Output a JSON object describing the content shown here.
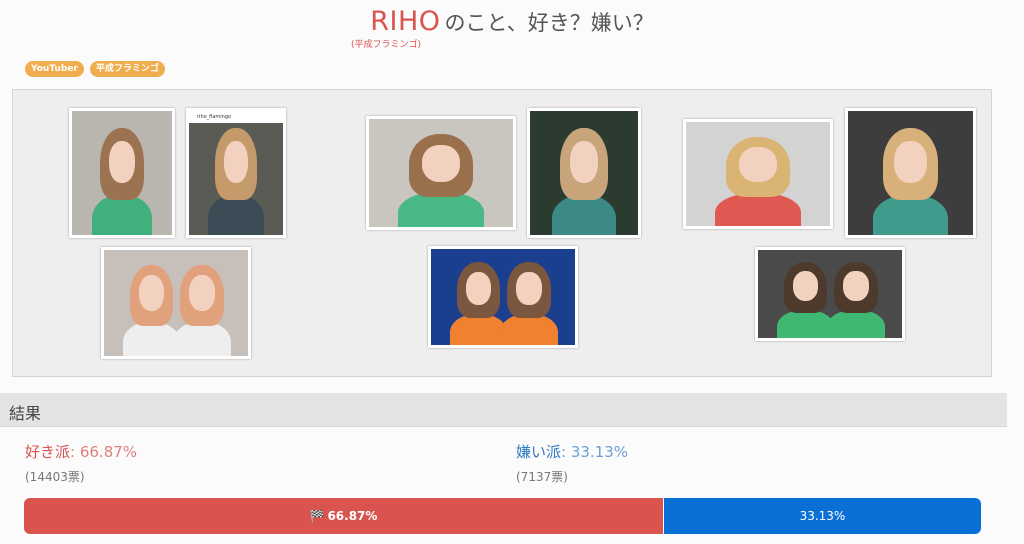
{
  "title": {
    "name": "RIHO",
    "rest": "のこと、好き？嫌い？",
    "sub": "(平成フラミンゴ)"
  },
  "tags": [
    "YouTuber",
    "平成フラミンゴ"
  ],
  "gallery": {
    "photos": [
      {
        "name": "photo-riho-green-sweater-1",
        "bg": "#b9b6b0",
        "hair": "#9c7350",
        "shirt": "#42b07d"
      },
      {
        "name": "photo-riho-instagram-post",
        "bg": "#5b5b55",
        "hair": "#c49a6a",
        "shirt": "#3c4c57",
        "caption": "riho_flamingo"
      },
      {
        "name": "photo-riho-green-sweater-2",
        "bg": "#c9c5bf",
        "hair": "#9a6f4c",
        "shirt": "#4ab884"
      },
      {
        "name": "photo-riho-graphic-tee",
        "bg": "#2b3b30",
        "hair": "#c8a47b",
        "shirt": "#3b8a86"
      },
      {
        "name": "photo-riho-red-sweater",
        "bg": "#d3d3d3",
        "hair": "#d9b472",
        "shirt": "#e05852"
      },
      {
        "name": "photo-riho-in-car",
        "bg": "#3d3d3d",
        "hair": "#d7b07a",
        "shirt": "#3f9b8c"
      },
      {
        "name": "photo-riho-peace-sign-duo",
        "bg": "#c7bfb9",
        "hair": "#e0a17c",
        "shirt": "#eeeeee"
      },
      {
        "name": "photo-riho-stage-duo",
        "bg": "#1b3f8f",
        "hair": "#7b5740",
        "shirt": "#f08130"
      },
      {
        "name": "photo-riho-sofa-duo",
        "bg": "#4a4a4a",
        "hair": "#4e3a2c",
        "shirt": "#3fb874"
      }
    ]
  },
  "results": {
    "heading": "結果",
    "like_label": "好き派",
    "like_pct": "66.87%",
    "like_votes": "(14403票)",
    "dislike_label": "嫌い派",
    "dislike_pct": "33.13%",
    "dislike_votes": "(7137票)",
    "like_ratio": 0.6687,
    "bar_like_text": "66.87%",
    "bar_dislike_text": "33.13%"
  },
  "colors": {
    "like": "#d9534f",
    "dislike": "#0b70d6",
    "tag": "#f0ad4e"
  },
  "icons": {
    "bar_like_icon": "flag-checkered-icon"
  }
}
